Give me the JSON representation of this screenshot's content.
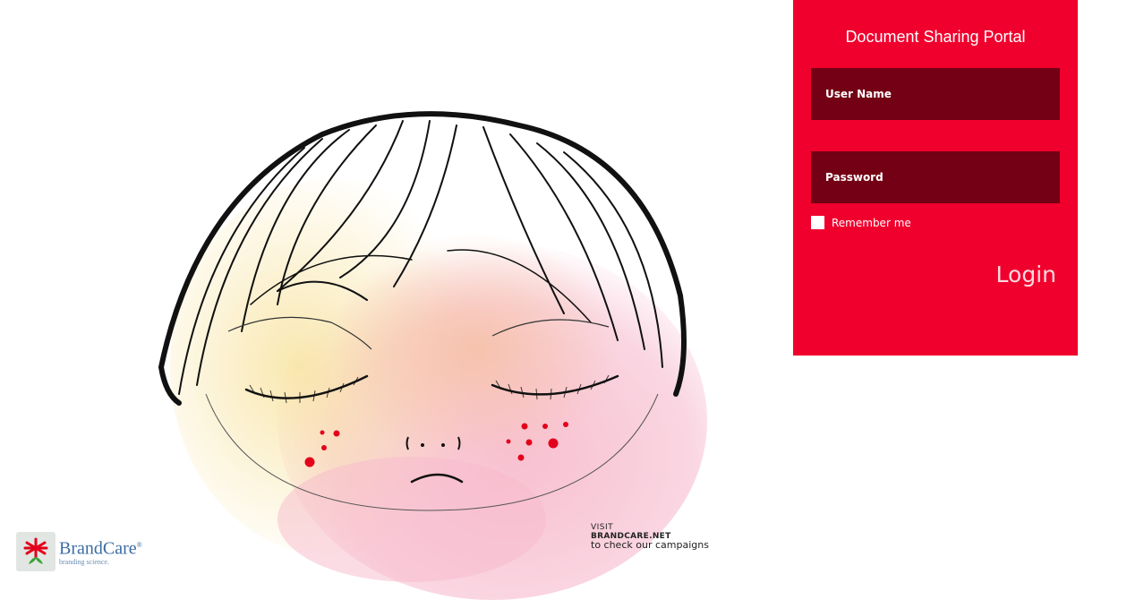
{
  "login": {
    "title": "Document Sharing Portal",
    "username_placeholder": "User Name",
    "password_placeholder": "Password",
    "remember_label": "Remember me",
    "login_label": "Login"
  },
  "campaign": {
    "visit": "VISIT",
    "site": "BRANDCARE.NET",
    "tagline": "to check our campaigns"
  },
  "brand": {
    "name": "BrandCare",
    "mark": "®",
    "tagline": "branding science."
  },
  "colors": {
    "panel": "#f0002d",
    "field": "#730014",
    "brand_blue": "#3b6ca2"
  },
  "icons": {
    "brand_logo": "flower-logo-icon",
    "illustration": "sad-girl-face-illustration"
  }
}
